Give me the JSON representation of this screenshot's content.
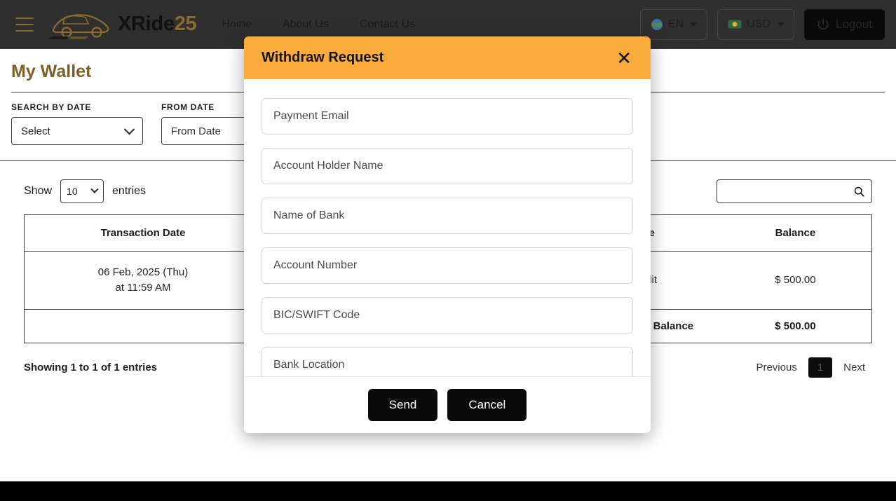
{
  "navbar": {
    "menu_icon": "hamburger-icon",
    "brand_primary": "XRide",
    "brand_suffix": "25",
    "links": [
      {
        "label": "Home"
      },
      {
        "label": "About Us"
      },
      {
        "label": "Contact Us"
      }
    ],
    "language": {
      "label": "EN",
      "icon": "globe-icon"
    },
    "currency": {
      "label": "USD",
      "icon": "money-icon"
    },
    "logout": {
      "label": "Logout",
      "icon": "power-icon"
    }
  },
  "page": {
    "title": "My Wallet"
  },
  "filters": {
    "search_by_date_label": "SEARCH BY DATE",
    "search_by_date_value": "Select",
    "from_date_label": "FROM DATE",
    "from_date_placeholder": "From Date",
    "calendar_icon": "calendar-icon"
  },
  "table_controls": {
    "show_label": "Show",
    "entries_label": "entries",
    "page_size": "10",
    "search_placeholder": "",
    "search_value": "",
    "search_icon": "search-icon"
  },
  "table": {
    "columns": [
      "Transaction Date",
      "Type",
      "Balance"
    ],
    "rows": [
      {
        "transaction_date_line1": "06 Feb, 2025 (Thu)",
        "transaction_date_line2": "at 11:59 AM",
        "type": "Credit",
        "balance": "$ 500.00"
      }
    ],
    "total_label": "Total Wallet Balance",
    "total_value": "$ 500.00"
  },
  "table_footer": {
    "showing_text": "Showing 1 to 1 of 1 entries",
    "previous_label": "Previous",
    "current_page": "1",
    "next_label": "Next"
  },
  "actions": {
    "withdraw_request_label": "Withdraw Request"
  },
  "modal": {
    "title": "Withdraw Request",
    "close_icon": "close-icon",
    "fields": [
      {
        "name": "payment-email-field",
        "placeholder": "Payment Email",
        "value": ""
      },
      {
        "name": "account-holder-name-field",
        "placeholder": "Account Holder Name",
        "value": ""
      },
      {
        "name": "name-of-bank-field",
        "placeholder": "Name of Bank",
        "value": ""
      },
      {
        "name": "account-number-field",
        "placeholder": "Account Number",
        "value": ""
      },
      {
        "name": "bic-swift-code-field",
        "placeholder": "BIC/SWIFT Code",
        "value": ""
      },
      {
        "name": "bank-location-field",
        "placeholder": "Bank Location",
        "value": ""
      }
    ],
    "send_label": "Send",
    "cancel_label": "Cancel"
  },
  "colors": {
    "accent_orange": "#fbab3c",
    "brand_gold": "#8a6a30",
    "dark": "#0a0a0a",
    "overlay_page": "#2e2e2e",
    "footer": "#000000"
  }
}
